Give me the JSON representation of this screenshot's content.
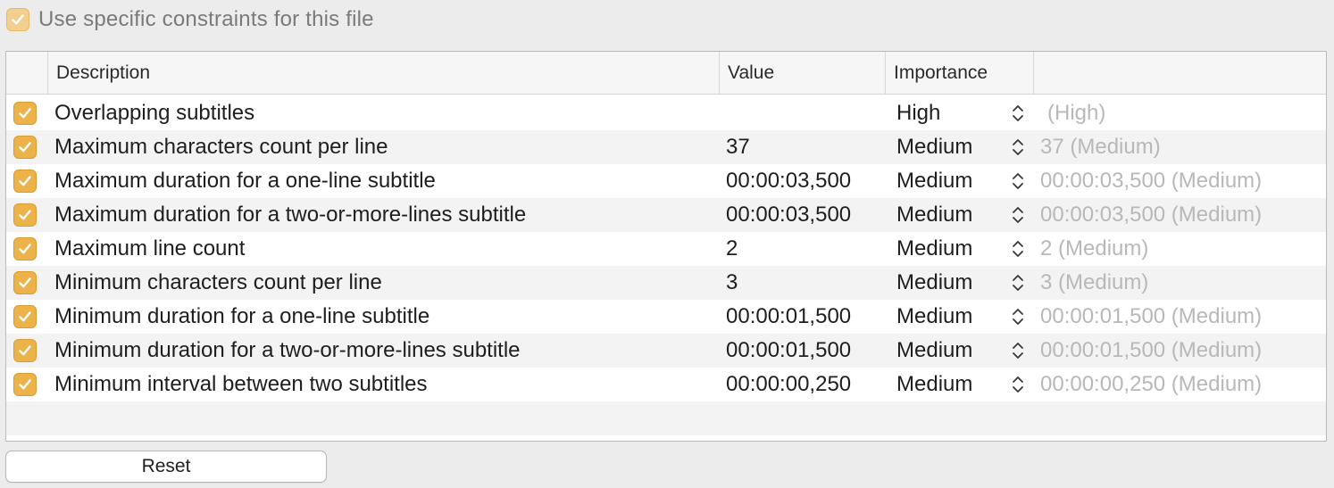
{
  "file_constraints": {
    "checked": true,
    "label": "Use specific constraints for this file"
  },
  "table": {
    "headers": {
      "description": "Description",
      "value": "Value",
      "importance": "Importance"
    },
    "rows": [
      {
        "checked": true,
        "description": "Overlapping subtitles",
        "value": "",
        "importance": "High",
        "default": "(High)"
      },
      {
        "checked": true,
        "description": "Maximum characters count per line",
        "value": "37",
        "importance": "Medium",
        "default": "37 (Medium)"
      },
      {
        "checked": true,
        "description": "Maximum duration for a one-line subtitle",
        "value": "00:00:03,500",
        "importance": "Medium",
        "default": "00:00:03,500 (Medium)"
      },
      {
        "checked": true,
        "description": "Maximum duration for a two-or-more-lines subtitle",
        "value": "00:00:03,500",
        "importance": "Medium",
        "default": "00:00:03,500 (Medium)"
      },
      {
        "checked": true,
        "description": "Maximum line count",
        "value": "2",
        "importance": "Medium",
        "default": "2 (Medium)"
      },
      {
        "checked": true,
        "description": "Minimum characters count per line",
        "value": "3",
        "importance": "Medium",
        "default": "3 (Medium)"
      },
      {
        "checked": true,
        "description": "Minimum duration for a one-line subtitle",
        "value": "00:00:01,500",
        "importance": "Medium",
        "default": "00:00:01,500 (Medium)"
      },
      {
        "checked": true,
        "description": "Minimum duration for a two-or-more-lines subtitle",
        "value": "00:00:01,500",
        "importance": "Medium",
        "default": "00:00:01,500 (Medium)"
      },
      {
        "checked": true,
        "description": "Minimum interval between two subtitles",
        "value": "00:00:00,250",
        "importance": "Medium",
        "default": "00:00:00,250 (Medium)"
      }
    ]
  },
  "buttons": {
    "reset_label": "Reset"
  },
  "icons": {
    "checkbox": "checkmark-icon",
    "importance_stepper": "up-down-chevron-icon"
  },
  "colors": {
    "checkbox_accent": "#ebb34a",
    "default_text": "#b8b8b8",
    "alt_row": "#f3f3f3"
  }
}
